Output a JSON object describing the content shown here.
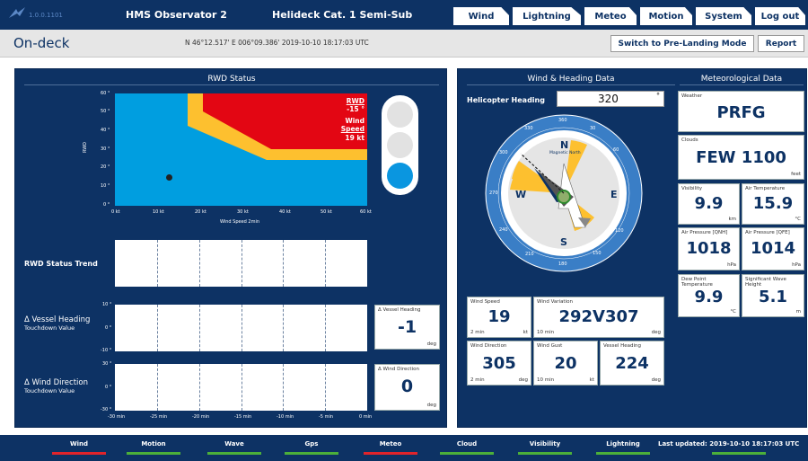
{
  "top": {
    "version": "1.0.0.1101",
    "vessel": "HMS Observator 2",
    "helideck": "Helideck Cat. 1 Semi-Sub",
    "nav": [
      "Wind",
      "Lightning",
      "Meteo",
      "Motion",
      "System",
      "Log out"
    ]
  },
  "header": {
    "title": "On-deck",
    "position": "N 46°12.517' E 006°09.386' 2019-10-10 18:17:03 UTC",
    "switch_label": "Switch to Pre-Landing Mode",
    "report_label": "Report"
  },
  "rwd": {
    "title": "RWD Status",
    "ylabel": "RWD",
    "xlabel": "Wind Speed 2min",
    "yticks": [
      "60 °",
      "50 °",
      "40 °",
      "30 °",
      "20 °",
      "10 °",
      "0 °"
    ],
    "xticks": [
      "0 kt",
      "10 kt",
      "20 kt",
      "30 kt",
      "40 kt",
      "50 kt",
      "60 kt"
    ],
    "rwd_label": "RWD",
    "rwd_value": "-15 °",
    "ws_label1": "Wind",
    "ws_label2": "Speed",
    "ws_value": "19 kt",
    "point": {
      "x": 13,
      "y": 15
    }
  },
  "trend": {
    "title": "RWD Status Trend"
  },
  "vessel_heading": {
    "title": "Δ Vessel Heading",
    "sub": "Touchdown Value",
    "yticks": [
      "10 °",
      "0 °",
      "-10 °"
    ],
    "box_label": "Δ Vessel Heading",
    "value": "-1",
    "unit": "deg"
  },
  "wind_dir": {
    "title": "Δ Wind Direction",
    "sub": "Touchdown Value",
    "yticks": [
      "30 °",
      "0 °",
      "-30 °"
    ],
    "box_label": "Δ Wind Direction",
    "value": "0",
    "unit": "deg",
    "xticks": [
      "-30 min",
      "-25 min",
      "-20 min",
      "-15 min",
      "-10 min",
      "-5 min",
      "0 min"
    ]
  },
  "wh": {
    "title": "Wind & Heading Data",
    "heading_label": "Helicopter Heading",
    "heading_value": "320",
    "heading_unit": "°",
    "compass": {
      "n": "N",
      "e": "E",
      "s": "S",
      "w": "W",
      "mag": "Magnetic North",
      "degs": [
        "360",
        "30",
        "60",
        "120",
        "150",
        "180",
        "210",
        "240",
        "270",
        "300",
        "330"
      ]
    },
    "wind_speed": {
      "label": "Wind Speed",
      "value": "19",
      "sub": "2 min",
      "unit": "kt"
    },
    "wind_var": {
      "label": "Wind Variation",
      "value": "292V307",
      "sub": "10 min",
      "unit": "deg"
    },
    "wind_dir": {
      "label": "Wind Direction",
      "value": "305",
      "sub": "2 min",
      "unit": "deg"
    },
    "wind_gust": {
      "label": "Wind Gust",
      "value": "20",
      "sub": "10 min",
      "unit": "kt"
    },
    "vessel_head": {
      "label": "Vessel Heading",
      "value": "224",
      "unit": "deg"
    }
  },
  "met": {
    "title": "Meteorological Data",
    "weather": {
      "label": "Weather",
      "value": "PRFG"
    },
    "clouds": {
      "label": "Clouds",
      "value": "FEW 1100",
      "unit": "feet"
    },
    "visibility": {
      "label": "Visibility",
      "value": "9.9",
      "unit": "km"
    },
    "air_temp": {
      "label": "Air Temperature",
      "value": "15.9",
      "unit": "°C"
    },
    "qnh": {
      "label": "Air Pressure [QNH]",
      "value": "1018",
      "unit": "hPa"
    },
    "qfe": {
      "label": "Air Pressure [QFE]",
      "value": "1014",
      "unit": "hPa"
    },
    "dew": {
      "label": "Dew Point Temperature",
      "value": "9.9",
      "unit": "°C"
    },
    "wave": {
      "label": "Significant Wave Height",
      "value": "5.1",
      "unit": "m"
    }
  },
  "status": {
    "items": [
      {
        "label": "Wind",
        "color": "#e0242b"
      },
      {
        "label": "Motion",
        "color": "#4caf3a"
      },
      {
        "label": "Wave",
        "color": "#4caf3a"
      },
      {
        "label": "Gps",
        "color": "#4caf3a"
      },
      {
        "label": "Meteo",
        "color": "#e0242b"
      },
      {
        "label": "Cloud",
        "color": "#4caf3a"
      },
      {
        "label": "Visibility",
        "color": "#4caf3a"
      },
      {
        "label": "Lightning",
        "color": "#4caf3a"
      }
    ],
    "last_updated": "Last updated: 2019-10-10 18:17:03 UTC"
  }
}
